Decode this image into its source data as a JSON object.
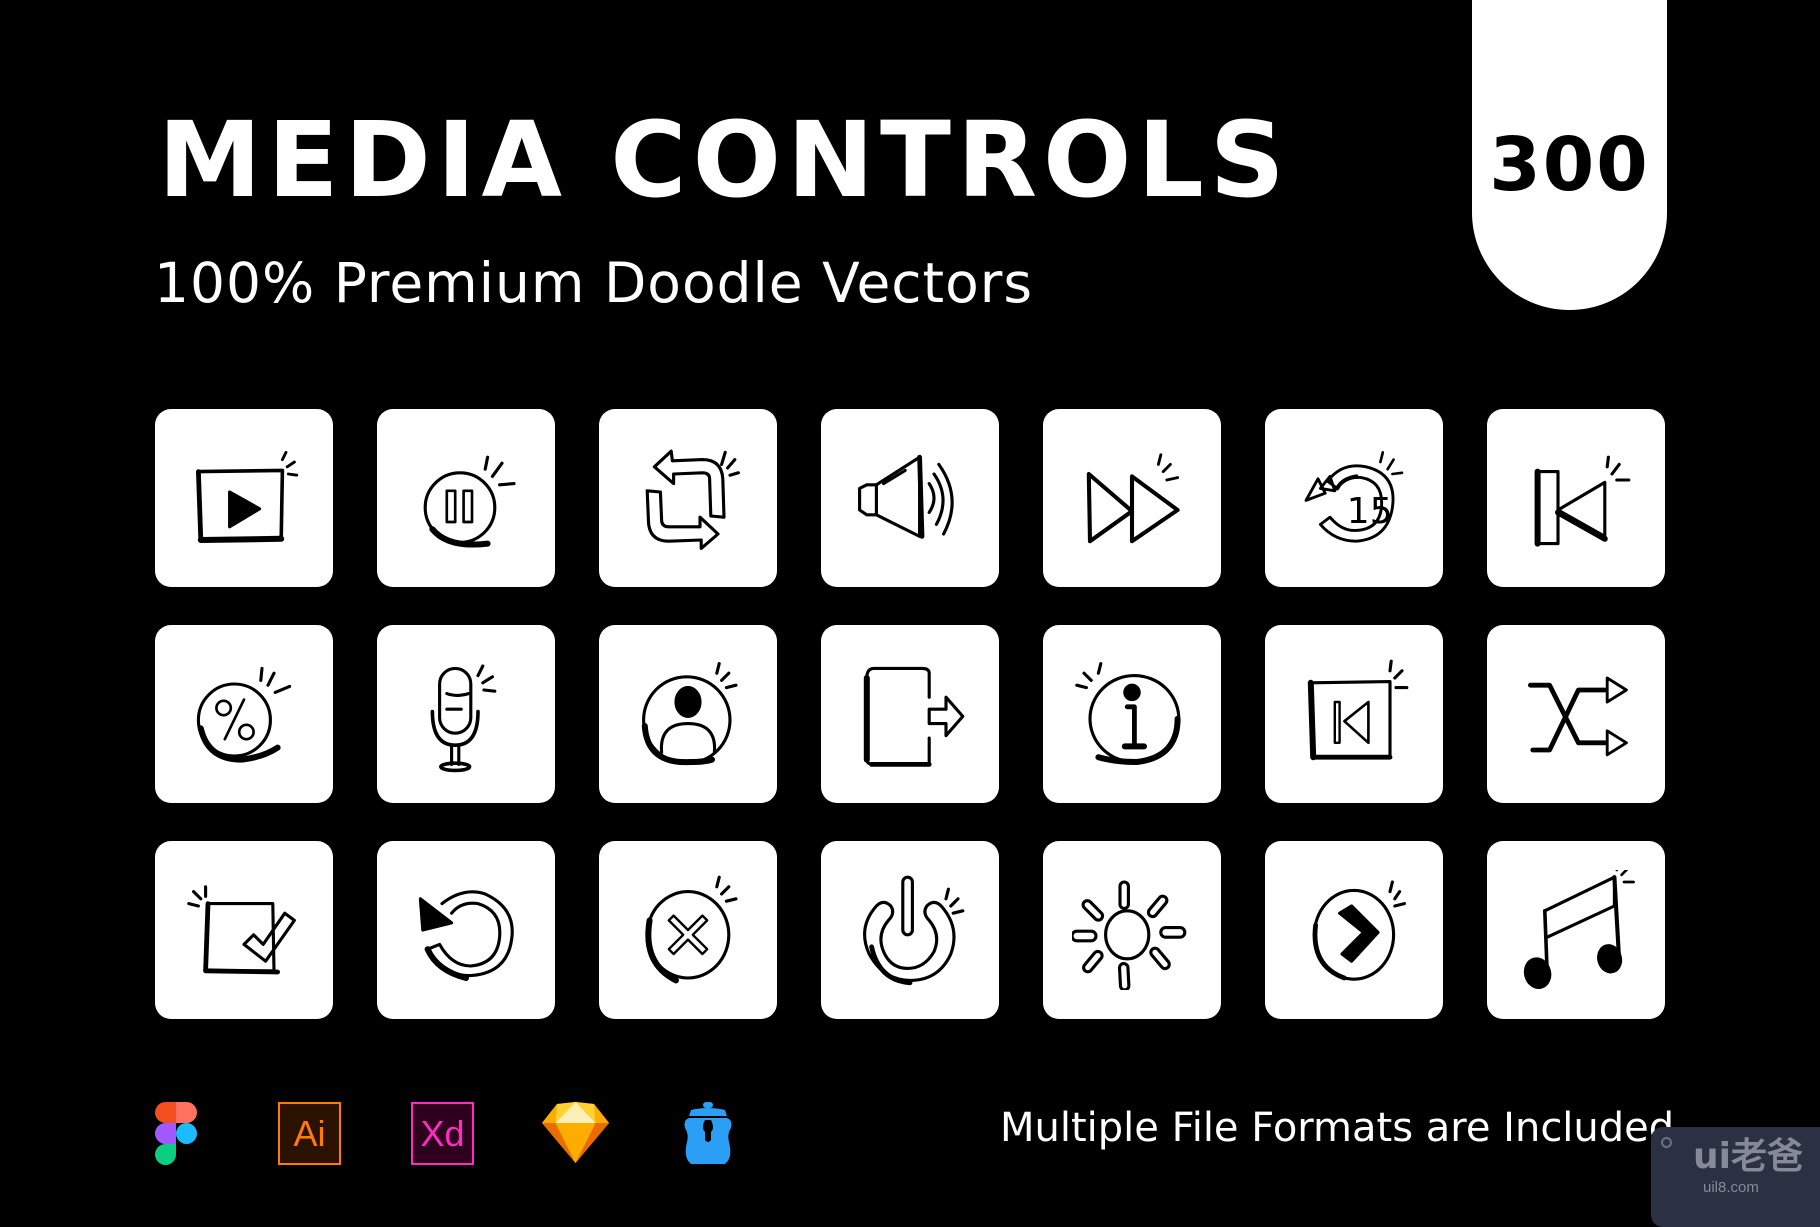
{
  "header": {
    "title": "MEDIA CONTROLS",
    "subtitle": "100% Premium Doodle Vectors",
    "count_badge": "300"
  },
  "icons": [
    {
      "name": "play-icon"
    },
    {
      "name": "pause-icon"
    },
    {
      "name": "repeat-icon"
    },
    {
      "name": "volume-icon"
    },
    {
      "name": "fast-forward-icon"
    },
    {
      "name": "rewind-15-icon",
      "label": "15"
    },
    {
      "name": "skip-back-icon"
    },
    {
      "name": "percent-icon"
    },
    {
      "name": "microphone-icon"
    },
    {
      "name": "user-icon"
    },
    {
      "name": "exit-icon"
    },
    {
      "name": "info-icon"
    },
    {
      "name": "previous-track-icon"
    },
    {
      "name": "shuffle-icon"
    },
    {
      "name": "checkbox-icon"
    },
    {
      "name": "replay-icon"
    },
    {
      "name": "close-icon"
    },
    {
      "name": "power-icon"
    },
    {
      "name": "brightness-icon"
    },
    {
      "name": "next-icon"
    },
    {
      "name": "music-note-icon"
    }
  ],
  "footer": {
    "formats": [
      {
        "name": "figma-logo"
      },
      {
        "name": "illustrator-logo",
        "label": "Ai",
        "color": "#ff7c00",
        "fill": "#2a1100"
      },
      {
        "name": "xd-logo",
        "label": "Xd",
        "color": "#ff2bc2",
        "fill": "#2e001e"
      },
      {
        "name": "sketch-logo"
      },
      {
        "name": "iconjar-logo",
        "color": "#2b9ff5"
      }
    ],
    "text": "Multiple File Formats are Included"
  },
  "watermark": {
    "logo": "ui老爸",
    "url": "uil8.com"
  }
}
